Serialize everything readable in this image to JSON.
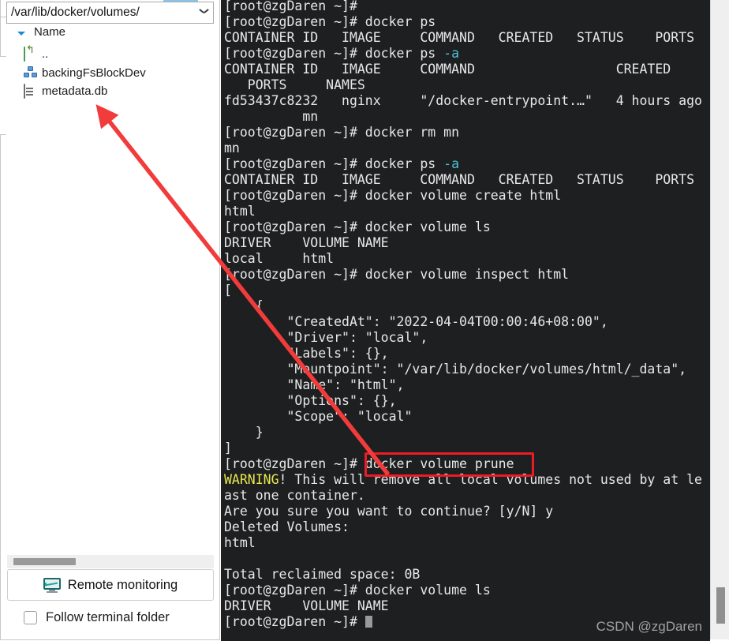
{
  "file_panel": {
    "path_value": "/var/lib/docker/volumes/",
    "chevron_icon": "chevron-down-icon",
    "column_header": "Name",
    "sort_caret_icon": "sort-descending-caret-icon",
    "rows": [
      {
        "name": "..",
        "icon": "parent-folder-icon"
      },
      {
        "name": "backingFsBlockDev",
        "icon": "block-device-icon"
      },
      {
        "name": "metadata.db",
        "icon": "database-file-icon"
      }
    ],
    "remote_monitoring_label": "Remote monitoring",
    "remote_monitoring_icon": "monitor-waveform-icon",
    "follow_terminal_folder_label": "Follow terminal folder",
    "follow_terminal_folder_checked": false
  },
  "terminal": {
    "prompt": "[root@zgDaren ~]#",
    "watermark": "CSDN @zgDaren",
    "cursor_visible": true,
    "colors": {
      "background": "#1d1f21",
      "foreground": "#e8e8e8",
      "flag_cyan": "#4fc1d6",
      "warning_yellow": "#e8e84a"
    },
    "lines": [
      {
        "segments": [
          {
            "t": "[root@zgDaren ~]# ",
            "c": "white"
          }
        ]
      },
      {
        "segments": [
          {
            "t": "[root@zgDaren ~]# docker ps",
            "c": "white"
          }
        ]
      },
      {
        "segments": [
          {
            "t": "CONTAINER ID   IMAGE     COMMAND   CREATED   STATUS    PORTS",
            "c": "white"
          }
        ]
      },
      {
        "segments": [
          {
            "t": "[root@zgDaren ~]# docker ps ",
            "c": "white"
          },
          {
            "t": "-a",
            "c": "cyan"
          }
        ]
      },
      {
        "segments": [
          {
            "t": "CONTAINER ID   IMAGE     COMMAND                  CREATED",
            "c": "white"
          }
        ]
      },
      {
        "segments": [
          {
            "t": "   PORTS     NAMES",
            "c": "white"
          }
        ]
      },
      {
        "segments": [
          {
            "t": "fd53437c8232   nginx     \"/docker-entrypoint.…\"   4 hours ago",
            "c": "white"
          }
        ]
      },
      {
        "segments": [
          {
            "t": "          mn",
            "c": "white"
          }
        ]
      },
      {
        "segments": [
          {
            "t": "[root@zgDaren ~]# docker rm mn",
            "c": "white"
          }
        ]
      },
      {
        "segments": [
          {
            "t": "mn",
            "c": "white"
          }
        ]
      },
      {
        "segments": [
          {
            "t": "[root@zgDaren ~]# docker ps ",
            "c": "white"
          },
          {
            "t": "-a",
            "c": "cyan"
          }
        ]
      },
      {
        "segments": [
          {
            "t": "CONTAINER ID   IMAGE     COMMAND   CREATED   STATUS    PORTS",
            "c": "white"
          }
        ]
      },
      {
        "segments": [
          {
            "t": "[root@zgDaren ~]# docker volume create html",
            "c": "white"
          }
        ]
      },
      {
        "segments": [
          {
            "t": "html",
            "c": "white"
          }
        ]
      },
      {
        "segments": [
          {
            "t": "[root@zgDaren ~]# docker volume ls",
            "c": "white"
          }
        ]
      },
      {
        "segments": [
          {
            "t": "DRIVER    VOLUME NAME",
            "c": "white"
          }
        ]
      },
      {
        "segments": [
          {
            "t": "local     html",
            "c": "white"
          }
        ]
      },
      {
        "segments": [
          {
            "t": "[root@zgDaren ~]# docker volume inspect html",
            "c": "white"
          }
        ]
      },
      {
        "segments": [
          {
            "t": "[",
            "c": "white"
          }
        ]
      },
      {
        "segments": [
          {
            "t": "    {",
            "c": "white"
          }
        ]
      },
      {
        "segments": [
          {
            "t": "        \"CreatedAt\": \"2022-04-04T00:00:46+08:00\",",
            "c": "white"
          }
        ]
      },
      {
        "segments": [
          {
            "t": "        \"Driver\": \"local\",",
            "c": "white"
          }
        ]
      },
      {
        "segments": [
          {
            "t": "        \"Labels\": {},",
            "c": "white"
          }
        ]
      },
      {
        "segments": [
          {
            "t": "        \"Mountpoint\": \"/var/lib/docker/volumes/html/_data\",",
            "c": "white"
          }
        ]
      },
      {
        "segments": [
          {
            "t": "        \"Name\": \"html\",",
            "c": "white"
          }
        ]
      },
      {
        "segments": [
          {
            "t": "        \"Options\": {},",
            "c": "white"
          }
        ]
      },
      {
        "segments": [
          {
            "t": "        \"Scope\": \"local\"",
            "c": "white"
          }
        ]
      },
      {
        "segments": [
          {
            "t": "    }",
            "c": "white"
          }
        ]
      },
      {
        "segments": [
          {
            "t": "]",
            "c": "white"
          }
        ]
      },
      {
        "segments": [
          {
            "t": "[root@zgDaren ~]# docker volume prune",
            "c": "white"
          }
        ]
      },
      {
        "segments": [
          {
            "t": "WARNING",
            "c": "yellow"
          },
          {
            "t": "! This will remove all local volumes not used by at le",
            "c": "white"
          }
        ]
      },
      {
        "segments": [
          {
            "t": "ast one container.",
            "c": "white"
          }
        ]
      },
      {
        "segments": [
          {
            "t": "Are you sure you want to continue? [y/N] y",
            "c": "white"
          }
        ]
      },
      {
        "segments": [
          {
            "t": "Deleted Volumes:",
            "c": "white"
          }
        ]
      },
      {
        "segments": [
          {
            "t": "html",
            "c": "white"
          }
        ]
      },
      {
        "segments": [
          {
            "t": "",
            "c": "white"
          }
        ]
      },
      {
        "segments": [
          {
            "t": "Total reclaimed space: 0B",
            "c": "white"
          }
        ]
      },
      {
        "segments": [
          {
            "t": "[root@zgDaren ~]# docker volume ls",
            "c": "white"
          }
        ]
      },
      {
        "segments": [
          {
            "t": "DRIVER    VOLUME NAME",
            "c": "white"
          }
        ]
      },
      {
        "segments": [
          {
            "t": "[root@zgDaren ~]# ",
            "c": "white",
            "cursor": true
          }
        ]
      }
    ]
  },
  "annotations": {
    "highlight_box_label": "docker volume prune",
    "arrow_color": "#ed1c24",
    "box_color": "#ed1c24",
    "arrow_from": "docker volume prune command",
    "arrow_to": "/var/lib/docker/volumes/ file list"
  },
  "scrollbars": {
    "vertical_position": "bottom",
    "horizontal_position": "left"
  }
}
